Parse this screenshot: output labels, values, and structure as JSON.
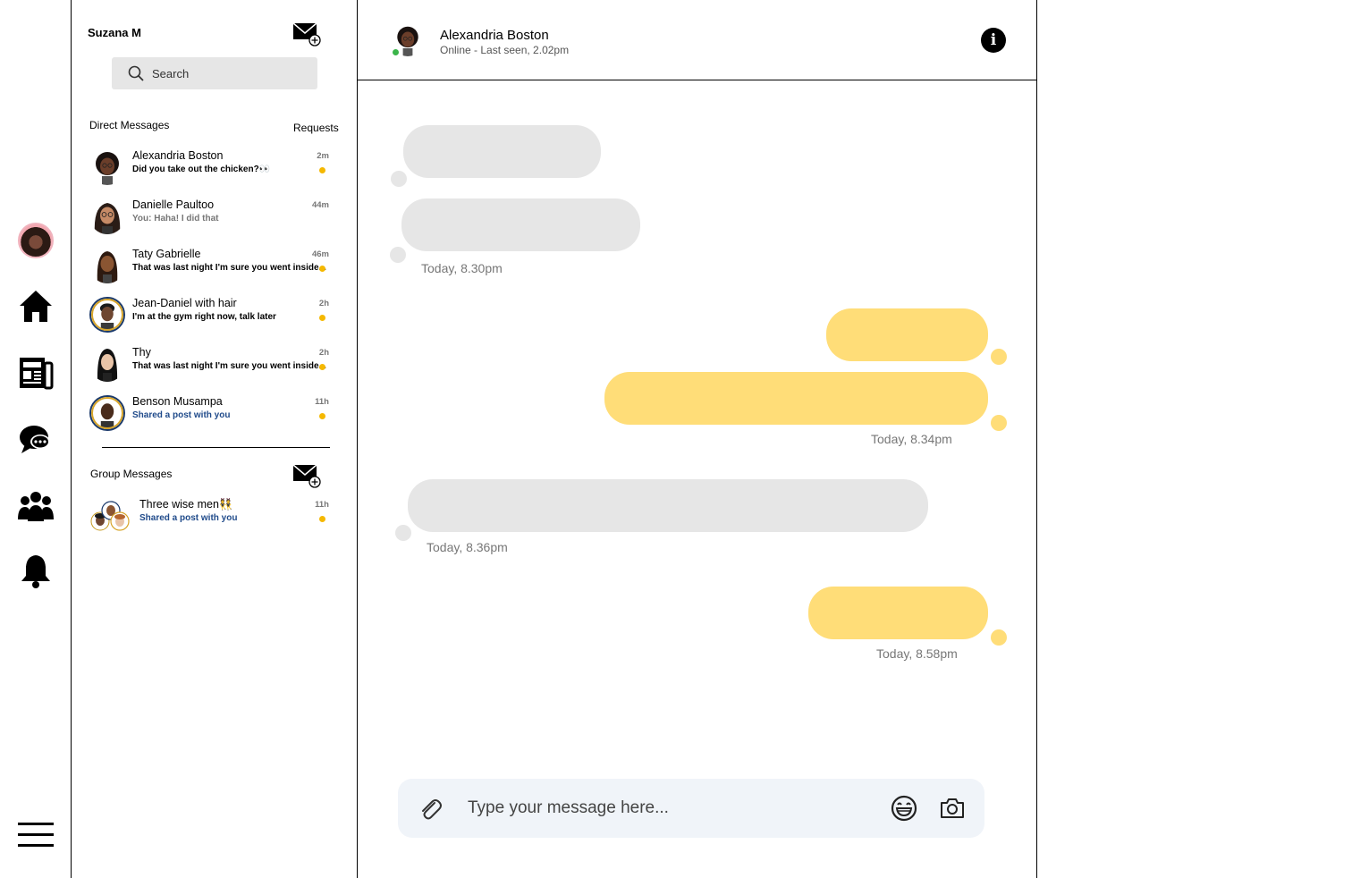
{
  "colors": {
    "incoming_bubble": "#e6e6e6",
    "outgoing_bubble": "#ffdd78",
    "unread_dot": "#f5b800",
    "online": "#3bb54a",
    "link_blue": "#1f4a8a"
  },
  "rail": {
    "icons": [
      "profile-avatar",
      "home-icon",
      "newspaper-icon",
      "chat-bubble-icon",
      "group-icon",
      "bell-icon",
      "hamburger-menu-icon"
    ]
  },
  "sidebar": {
    "user_name": "Suzana M",
    "search_placeholder": "Search",
    "direct_title": "Direct Messages",
    "requests_label": "Requests",
    "group_title": "Group Messages",
    "direct_messages": [
      {
        "name": "Alexandria Boston",
        "preview": "Did you take out the chicken?👀",
        "time": "2m",
        "unread": true
      },
      {
        "name": "Danielle Paultoo",
        "preview": "You: Haha! I did that",
        "time": "44m",
        "unread": false
      },
      {
        "name": "Taty Gabrielle",
        "preview": "That was last night I'm sure you went inside...",
        "time": "46m",
        "unread": true
      },
      {
        "name": "Jean-Daniel with hair",
        "preview": "I'm at the gym right now, talk later",
        "time": "2h",
        "unread": true
      },
      {
        "name": "Thy",
        "preview": "That was last night I'm sure you went inside...",
        "time": "2h",
        "unread": true
      },
      {
        "name": "Benson Musampa",
        "preview": "Shared a post with you",
        "time": "11h",
        "unread": true
      }
    ],
    "group_messages": [
      {
        "name": "Three wise men👯",
        "preview": "Shared a post with you",
        "time": "11h",
        "unread": true
      }
    ]
  },
  "chat": {
    "contact_name": "Alexandria Boston",
    "status": "Online - Last seen, 2.02pm",
    "info_glyph": "i",
    "timestamps": [
      "Today, 8.30pm",
      "Today, 8.34pm",
      "Today, 8.36pm",
      "Today, 8.58pm"
    ],
    "input_placeholder": "Type your message here..."
  }
}
